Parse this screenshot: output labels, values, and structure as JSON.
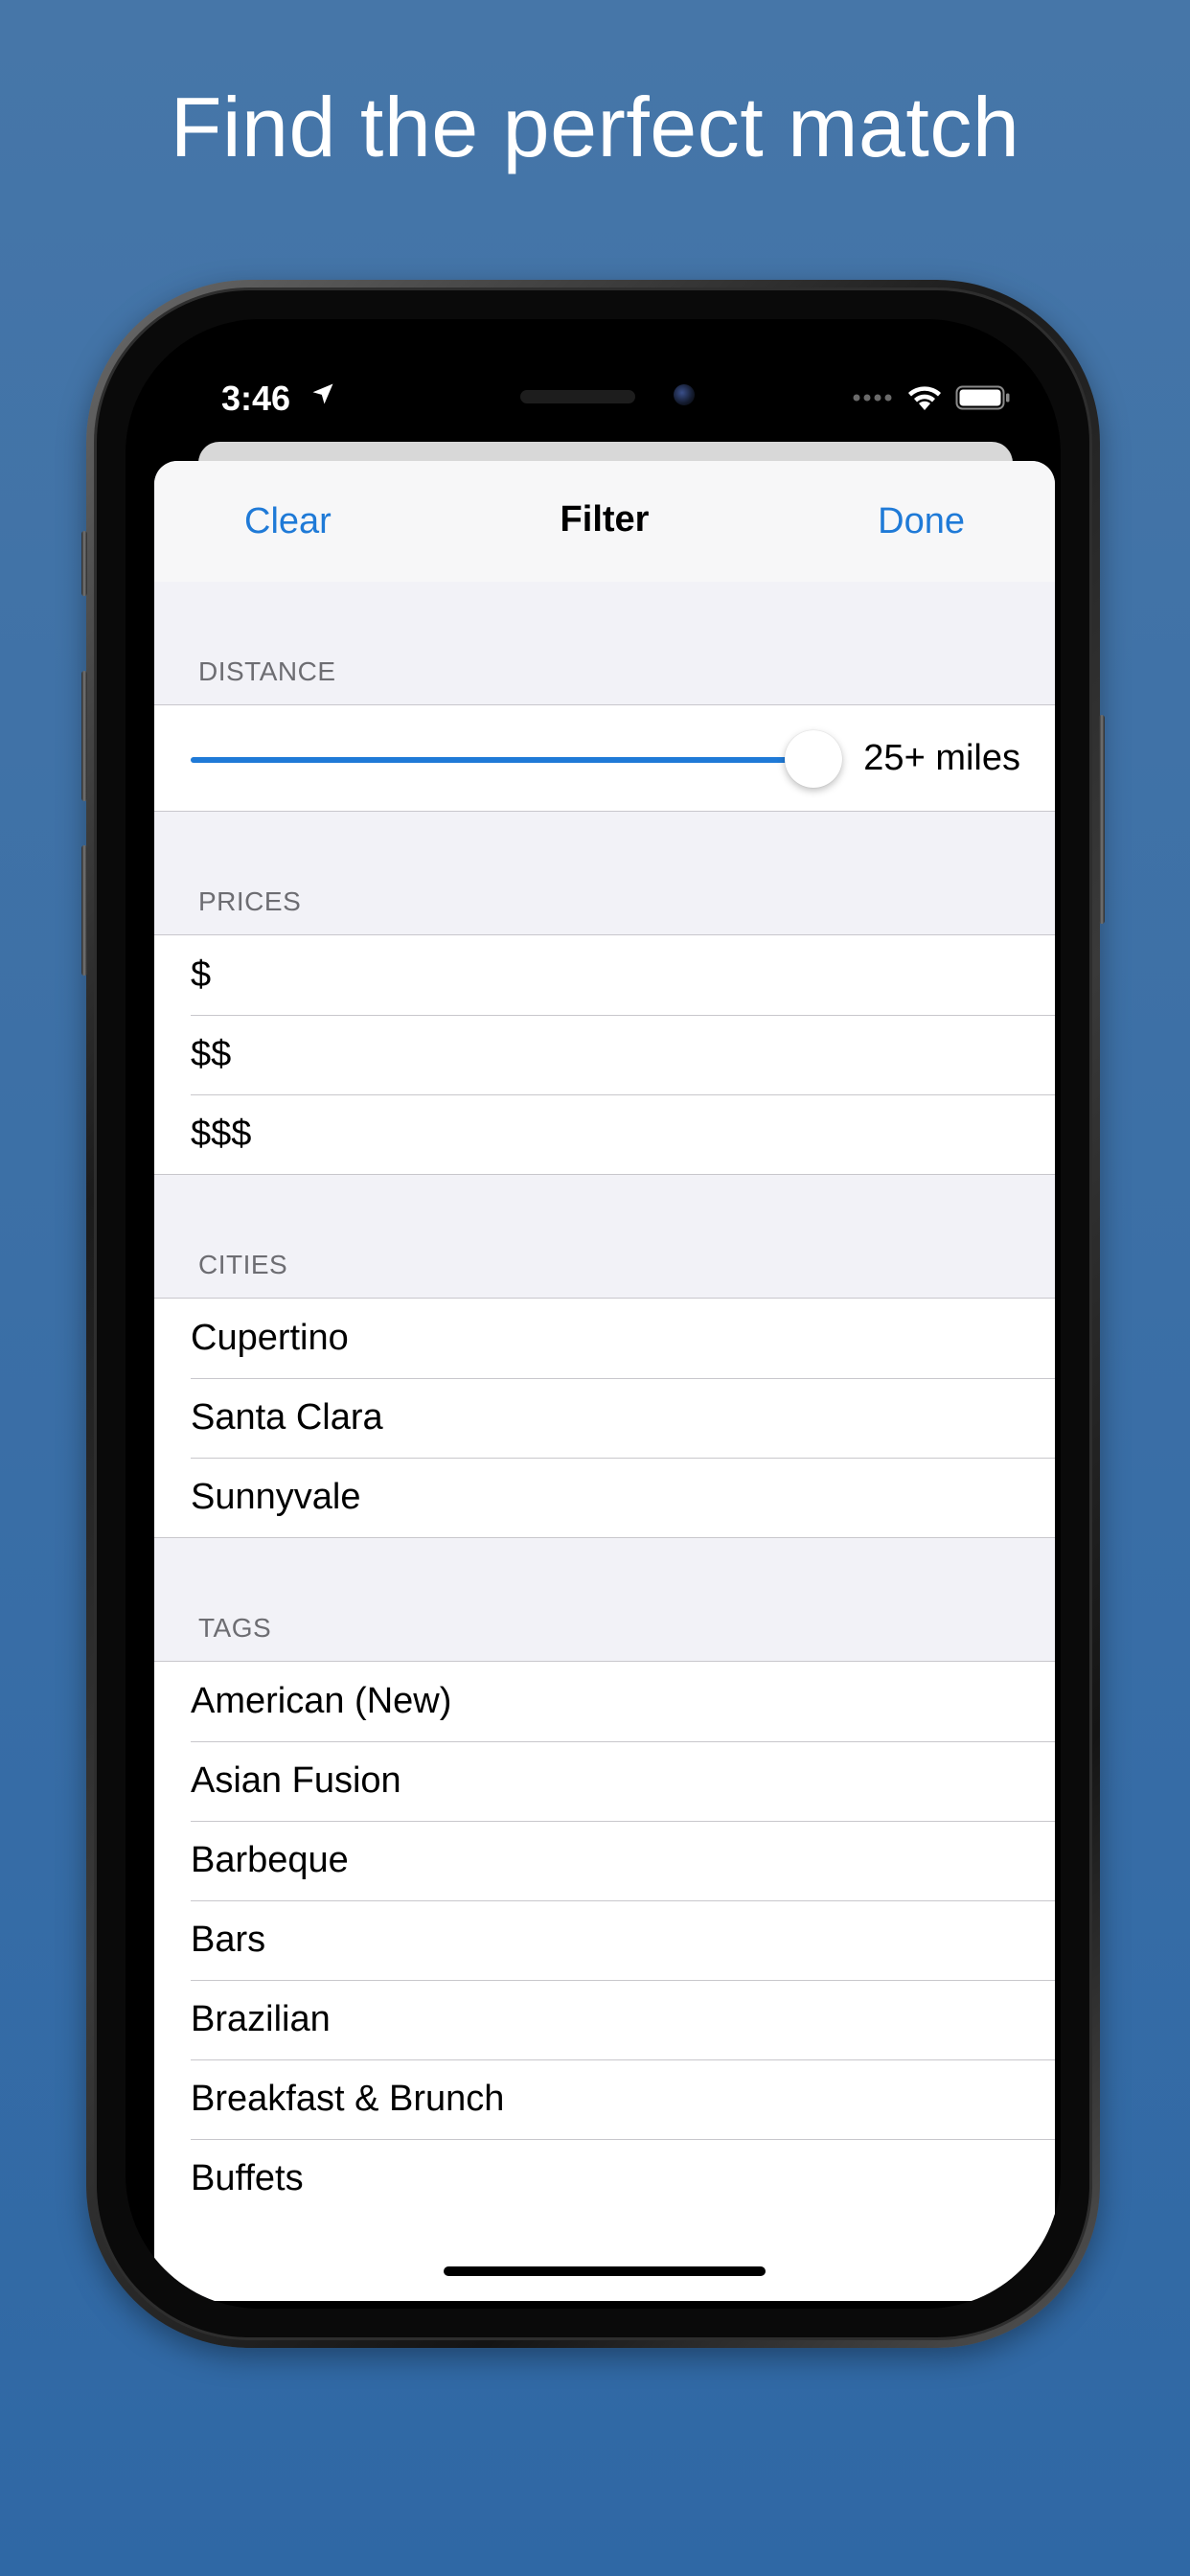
{
  "headline": "Find the perfect match",
  "status_bar": {
    "time": "3:46",
    "icons": [
      "location-arrow-icon",
      "signal-dots-icon",
      "wifi-icon",
      "battery-icon"
    ]
  },
  "navbar": {
    "clear_label": "Clear",
    "title": "Filter",
    "done_label": "Done"
  },
  "distance": {
    "header": "DISTANCE",
    "value_label": "25+ miles",
    "slider_fraction": 1.0
  },
  "prices": {
    "header": "PRICES",
    "items": [
      "$",
      "$$",
      "$$$"
    ]
  },
  "cities": {
    "header": "CITIES",
    "items": [
      "Cupertino",
      "Santa Clara",
      "Sunnyvale"
    ]
  },
  "tags": {
    "header": "TAGS",
    "items": [
      "American (New)",
      "Asian Fusion",
      "Barbeque",
      "Bars",
      "Brazilian",
      "Breakfast & Brunch",
      "Buffets"
    ]
  },
  "colors": {
    "accent": "#1f7ad7",
    "background": "#3b6fa6",
    "grouped_background": "#f2f2f7",
    "secondary_text": "#6d6d72"
  }
}
